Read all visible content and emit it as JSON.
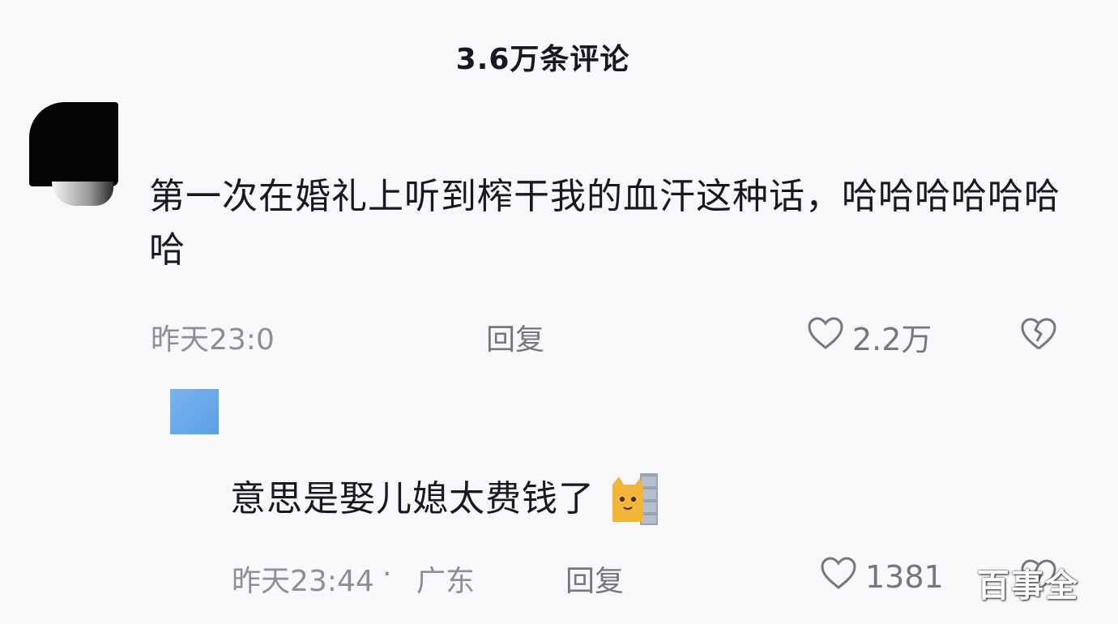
{
  "header": {
    "comment_count": "3.6万条评论"
  },
  "comment": {
    "text": "第一次在婚礼上听到榨干我的血汗这种话，哈哈哈哈哈哈哈",
    "time": "昨天23:0",
    "reply_label": "回复",
    "likes": "2.2万"
  },
  "reply": {
    "text": "意思是娶儿媳太费钱了",
    "emoji": "cat-hiding-behind-wall-emoji",
    "time": "昨天23:44",
    "separator": "·",
    "region": "广东",
    "reply_label": "回复",
    "likes": "1381"
  },
  "watermark": {
    "text": "百事全"
  },
  "colors": {
    "text": "#161823",
    "meta": "#8d8f98",
    "background": "#f8f8fb"
  }
}
